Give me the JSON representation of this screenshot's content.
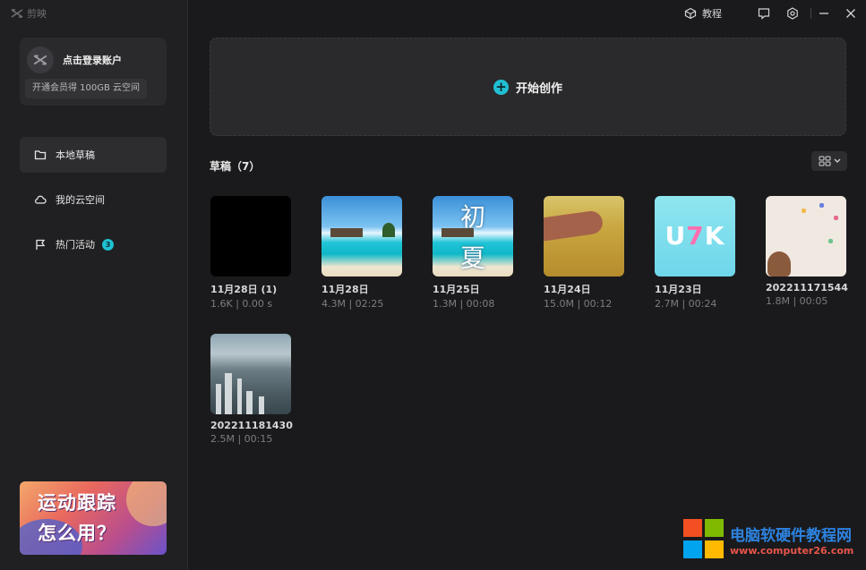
{
  "app": {
    "name": "剪映"
  },
  "account": {
    "login_text": "点击登录账户",
    "vip_text": "开通会员得 100GB 云空间"
  },
  "nav": [
    {
      "label": "本地草稿",
      "icon": "folder-icon",
      "active": true
    },
    {
      "label": "我的云空间",
      "icon": "cloud-icon",
      "active": false
    },
    {
      "label": "热门活动",
      "icon": "flag-icon",
      "active": false,
      "badge": "3"
    }
  ],
  "promo": {
    "line1": "运动跟踪",
    "line2": "怎么用？"
  },
  "topbar": {
    "tutorial_label": "教程",
    "icons": [
      "tutorial-icon",
      "feedback-icon",
      "settings-icon",
      "minimize-icon",
      "close-icon"
    ]
  },
  "create": {
    "label": "开始创作"
  },
  "drafts": {
    "title": "草稿（7）",
    "items": [
      {
        "date": "11月28日 (1)",
        "meta": "1.6K | 0.00 s",
        "thumb": "black"
      },
      {
        "date": "11月28日",
        "meta": "4.3M | 02:25",
        "thumb": "beach"
      },
      {
        "date": "11月25日",
        "meta": "1.3M | 00:08",
        "thumb": "beach-text",
        "thumb_text": [
          "初",
          "夏"
        ]
      },
      {
        "date": "11月24日",
        "meta": "15.0M | 00:12",
        "thumb": "wheat"
      },
      {
        "date": "11月23日",
        "meta": "2.7M | 00:24",
        "thumb": "lucky",
        "thumb_text": [
          "U",
          "7",
          "K"
        ]
      },
      {
        "date": "202211171544",
        "meta": "1.8M | 00:05",
        "thumb": "paper"
      },
      {
        "date": "202211181430",
        "meta": "2.5M | 00:15",
        "thumb": "city"
      }
    ]
  },
  "watermark": {
    "title": "电脑软硬件教程网",
    "url": "www.computer26.com"
  },
  "colors": {
    "accent": "#20c0d2",
    "background": "#1a1a1c",
    "sidebar": "#202022"
  }
}
